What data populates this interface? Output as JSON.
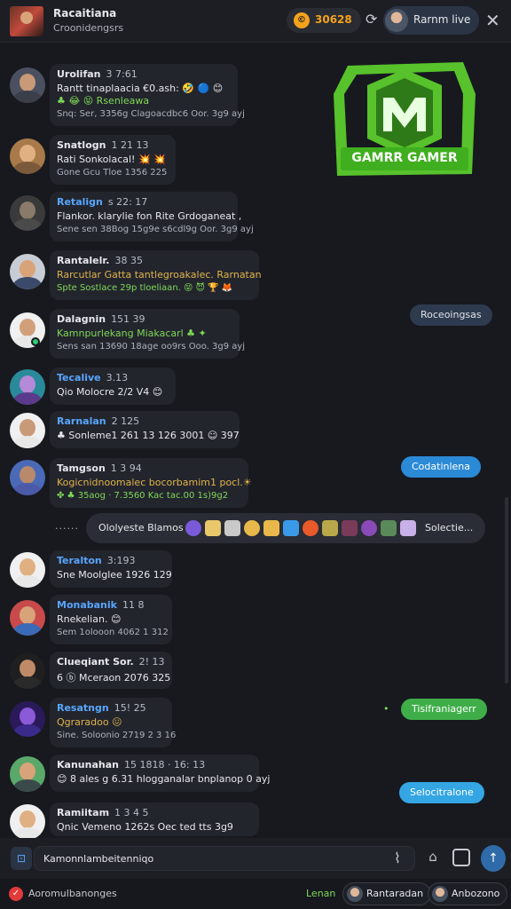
{
  "header": {
    "title": "Racaitiana",
    "subtitle": "Croonidengsrs",
    "coin_symbol": "©",
    "coins": "30628",
    "live_label": "Rarnm live"
  },
  "logo": {
    "letter": "M",
    "text": "GAMRR GAMER",
    "color": "#57c22b"
  },
  "messages": [
    {
      "name": "Urolifan",
      "time": "3 7:61",
      "text": "Rantt tinaplaacia €0.ash: 🤣 🔵 😊",
      "extra": "♣ 😂 😝 Rsenleawa",
      "meta": "Snq: Ser, 3356g  Clagoacdbc6  Oor.  3g9  ayj",
      "name_color": "#e6e8ec",
      "face": "#c99a78",
      "shirt": "#3a3f4a"
    },
    {
      "name": "Snatlogn",
      "time": "1 21 13",
      "text": "Rati Sonkolacal! 💥 💥",
      "meta": "Gone  Gcu  Tloe  1356 225",
      "name_color": "#e6e8ec",
      "face": "#e0b083",
      "shirt": "#7a5a3a"
    },
    {
      "name": "Retalign",
      "time": "s 22: 17",
      "text": "Flankor. klarylie fon  Rite  Grdoganeat ,",
      "meta": "Sene  sen  38Bog  15g9e  s6cdl9g  Oor.  3g9  ayj",
      "name_color": "#58a6ff",
      "face": "#8a7a6a",
      "shirt": "#4a4a4a"
    },
    {
      "name": "Rantalelr.",
      "time": "38 35",
      "text": "Rarcutlar Gatta  tantlegroakalec. Rarnatan",
      "meta": "Spte  Sostlace  29p  tloeliaan.  😝 😈 🏆 🦊",
      "name_color": "#e6e8ec",
      "face": "#d9a37a",
      "shirt": "#3b4a6a"
    },
    {
      "name": "Dalagnin",
      "time": "151 39",
      "text": "Kamnpurlekang Miakacarl ♣ ✦",
      "meta": "Sens  san  13690  18age  oo9rs  Ooo.  3g9  ayj",
      "name_color": "#e6e8ec",
      "face": "#d1a07a",
      "shirt": "#e8e8e8"
    },
    {
      "name": "Tecalive",
      "time": "3.13",
      "text": "Qio  Molocre  2/2  V4 😊",
      "name_color": "#58a6ff",
      "face": "#b58ad8",
      "shirt": "#5a3a8a"
    },
    {
      "name": "Rarnalan",
      "time": "2 125",
      "text": "♣  Sonleme1 261  13 126 3001  ☺  397",
      "name_color": "#58a6ff",
      "face": "#c99a78",
      "shirt": "#e8e8e8"
    },
    {
      "name": "Tamgson",
      "time": "1 3 94",
      "text": "Kogicnidnoomalec  bocorbamim1 pocl.☀",
      "meta": "✤ ♣  35aog · 7.3560  Kac  tac.00 1s)9g2",
      "name_color": "#e6e8ec",
      "face": "#b8896a",
      "shirt": "#4a5aa8"
    },
    {
      "name": "Teralton",
      "time": "3:193",
      "text": "Sne  Moolglee  1926 129",
      "name_color": "#58a6ff",
      "face": "#e0b083",
      "shirt": "#e8e8e8"
    },
    {
      "name": "Monabanik",
      "time": "11 8",
      "text": "Rnekelian. 😊",
      "meta": "Sem  1olooon  4062 1 312",
      "name_color": "#58a6ff",
      "face": "#d9a37a",
      "shirt": "#3a6ab8"
    },
    {
      "name": "Clueqiant Sor.",
      "time": "2! 13",
      "text": "6 ⓑ  Mceraon  2076  325",
      "name_color": "#e6e8ec",
      "face": "#c08a66",
      "shirt": "#2a2a2a"
    },
    {
      "name": "Resatngn",
      "time": "15! 25",
      "text": "Qgraradoo 😖",
      "meta": "Sine.  Soloonio  2719 2 3 16",
      "name_color": "#58a6ff",
      "face": "#8a5ad8",
      "shirt": "#3a2a8a"
    },
    {
      "name": "Kanunahan",
      "time": "15 1818 · 16: 13",
      "text": "😊  8 ales  g 6.31  hlogganalar bnplanop  0  ayj",
      "name_color": "#e6e8ec",
      "face": "#d9a37a",
      "shirt": "#3a4a4a"
    },
    {
      "name": "Ramiitam",
      "time": "1 3 4  5",
      "text": "Qnic  Vemeno  1262s  Oec ted  tts  3g9",
      "name_color": "#e6e8ec",
      "face": "#e0b083",
      "shirt": "#e8e8e8"
    }
  ],
  "right_bubbles": [
    {
      "text": "Roceoingsas"
    },
    {
      "text": "Codatinlena"
    },
    {
      "text": "Tisifraniagerr",
      "prefix": "•"
    },
    {
      "text": "Selocitralone"
    }
  ],
  "reaction_bar": {
    "dots": "······",
    "label": "Ololyeste Blamos",
    "selector": "Solectie...",
    "emoji_colors": [
      "#7a5ad8",
      "#e8c86a",
      "#c9c9c9",
      "#e8b84a",
      "#e8b84a",
      "#3a9ae8",
      "#e85a2a",
      "#b8a84a",
      "#7a3a5a",
      "#8a4ab8",
      "#5a8a5a",
      "#c8b0e8"
    ]
  },
  "composer": {
    "attach_icon": "paperclip-box",
    "placeholder": "Kamonnlambeitenniqo",
    "clip_glyph": "⌇",
    "home_glyph": "⌂",
    "box_glyph": "▣",
    "send_glyph": "↑"
  },
  "footer": {
    "icon_glyph": "✓",
    "status_text": "Aoromulbanonges",
    "link_text": "Lenan",
    "pill1": "Rantaradan",
    "pill2": "Anbozono"
  }
}
